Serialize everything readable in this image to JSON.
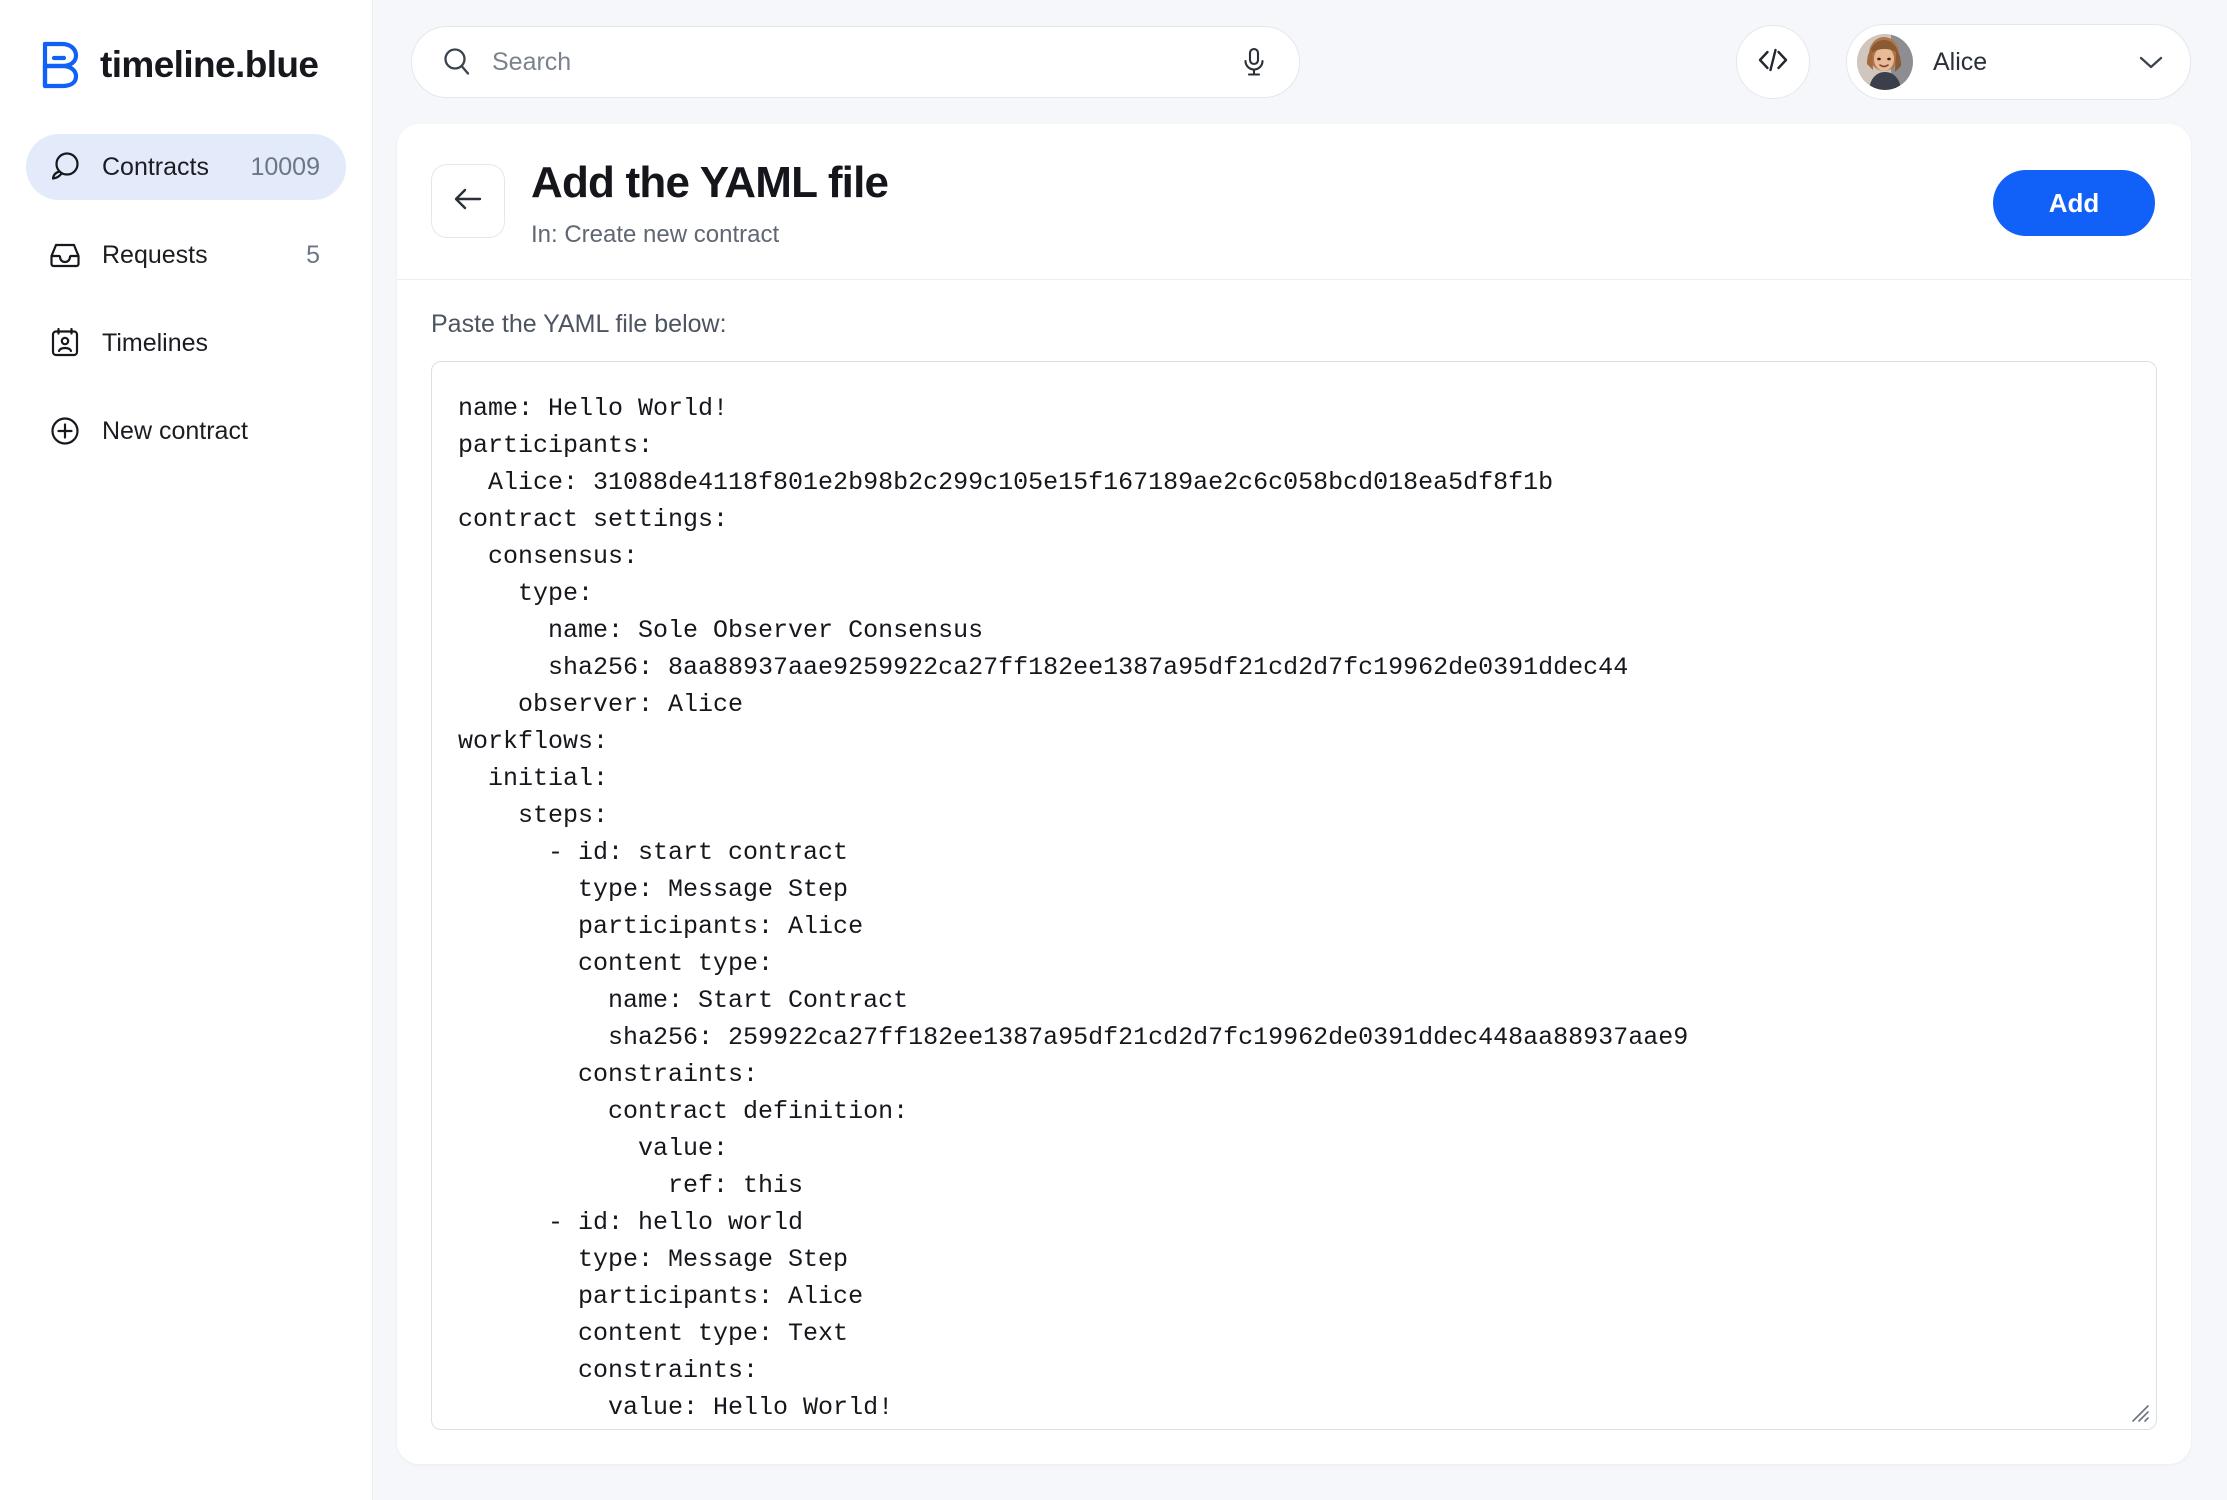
{
  "brand": {
    "name": "timeline.blue",
    "logo_icon": "timeline-b-logo"
  },
  "sidebar": {
    "items": [
      {
        "label": "Contracts",
        "count": "10009",
        "icon": "chat-bubble-icon",
        "active": true
      },
      {
        "label": "Requests",
        "count": "5",
        "icon": "inbox-icon",
        "active": false
      },
      {
        "label": "Timelines",
        "count": "",
        "icon": "contact-card-icon",
        "active": false
      },
      {
        "label": "New contract",
        "count": "",
        "icon": "plus-circle-icon",
        "active": false
      }
    ]
  },
  "topbar": {
    "search_placeholder": "Search",
    "search_value": "",
    "search_icon": "search-icon",
    "mic_icon": "microphone-icon",
    "code_icon": "code-brackets-icon",
    "user_name": "Alice",
    "chevron_icon": "chevron-down-icon"
  },
  "page": {
    "back_icon": "arrow-left-icon",
    "title": "Add the YAML file",
    "subtitle": "In: Create new contract",
    "primary_action": "Add"
  },
  "editor": {
    "label": "Paste the YAML file below:",
    "yaml": "name: Hello World!\nparticipants:\n  Alice: 31088de4118f801e2b98b2c299c105e15f167189ae2c6c058bcd018ea5df8f1b\ncontract settings:\n  consensus:\n    type:\n      name: Sole Observer Consensus\n      sha256: 8aa88937aae9259922ca27ff182ee1387a95df21cd2d7fc19962de0391ddec44\n    observer: Alice\nworkflows:\n  initial:\n    steps:\n      - id: start contract\n        type: Message Step\n        participants: Alice\n        content type:\n          name: Start Contract\n          sha256: 259922ca27ff182ee1387a95df21cd2d7fc19962de0391ddec448aa88937aae9\n        constraints:\n          contract definition:\n            value:\n              ref: this\n      - id: hello world\n        type: Message Step\n        participants: Alice\n        content type: Text\n        constraints:\n          value: Hello World!"
  },
  "colors": {
    "accent": "#1160f7",
    "sidebar_active_bg": "#e3eafa",
    "page_bg": "#f6f7fb",
    "text_primary": "#15171c",
    "text_muted": "#6d7684"
  }
}
